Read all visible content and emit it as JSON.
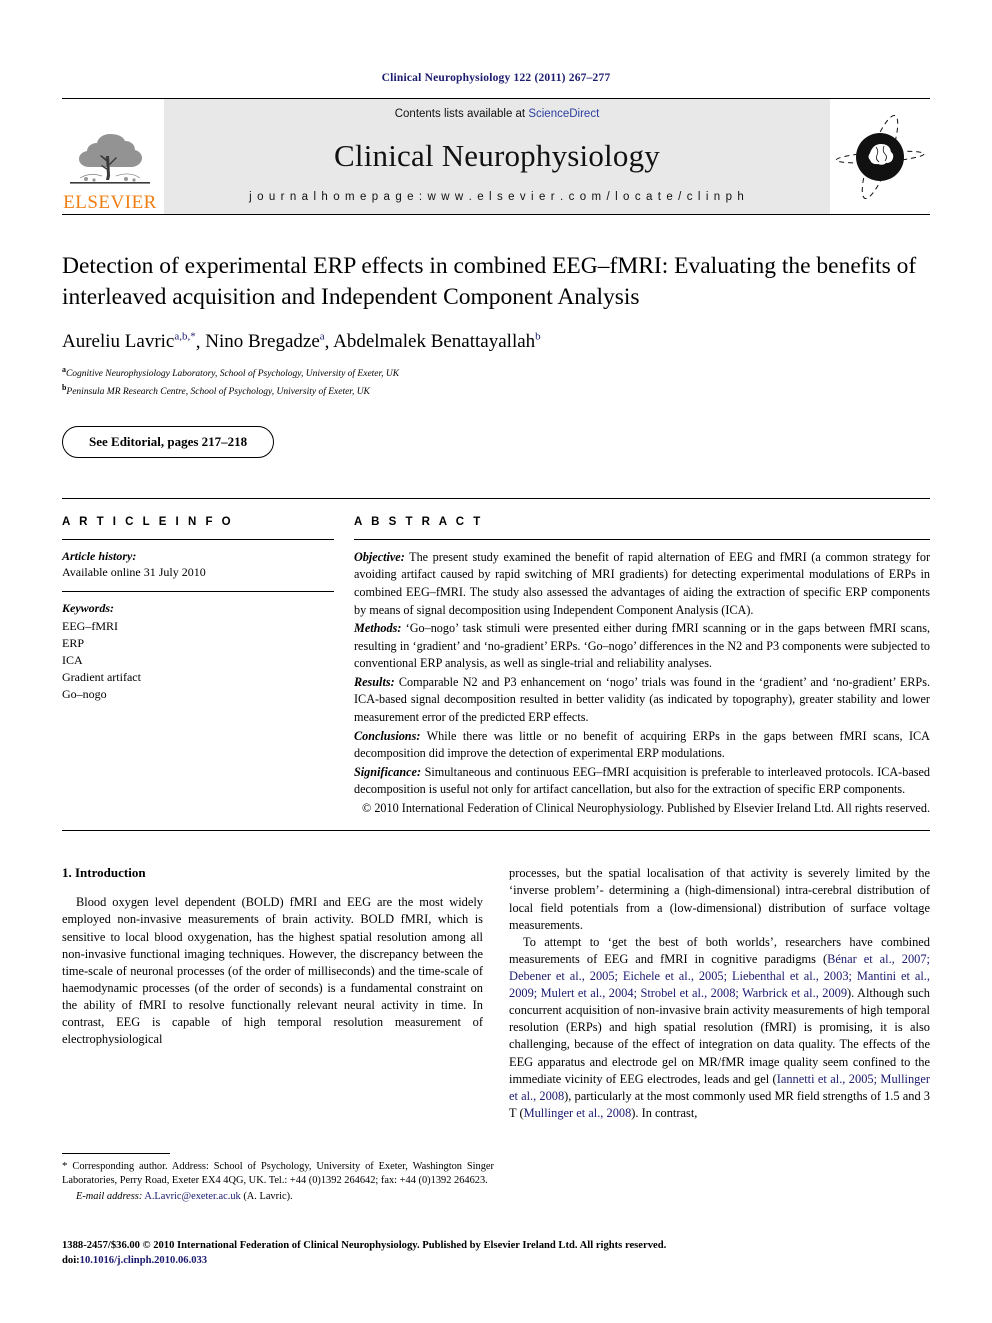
{
  "running_head": "Clinical Neurophysiology 122 (2011) 267–277",
  "masthead": {
    "contents_prefix": "Contents lists available at ",
    "sciencedirect": "ScienceDirect",
    "journal_name": "Clinical Neurophysiology",
    "homepage": "j o u r n a l   h o m e p a g e :   w w w . e l s e v i e r . c o m / l o c a t e / c l i n p h",
    "elsevier_wordmark": "ELSEVIER",
    "accent_orange": "#F07F13",
    "link_blue": "#2b3fa0",
    "banner_gray": "#e8e8e8"
  },
  "title": "Detection of experimental ERP effects in combined EEG–fMRI: Evaluating the benefits of interleaved acquisition and Independent Component Analysis",
  "authors": [
    {
      "name": "Aureliu Lavric",
      "sup": "a,b,*"
    },
    {
      "name": "Nino Bregadze",
      "sup": "a"
    },
    {
      "name": "Abdelmalek Benattayallah",
      "sup": "b"
    }
  ],
  "affiliations": [
    {
      "mark": "a",
      "text": "Cognitive Neurophysiology Laboratory, School of Psychology, University of Exeter, UK"
    },
    {
      "mark": "b",
      "text": "Peninsula MR Research Centre, School of Psychology, University of Exeter, UK"
    }
  ],
  "editorial_note": "See Editorial, pages 217–218",
  "article_info": {
    "heading": "A R T I C L E    I N F O",
    "history_label": "Article history:",
    "history_value": "Available online 31 July 2010",
    "keywords_label": "Keywords:",
    "keywords": [
      "EEG–fMRI",
      "ERP",
      "ICA",
      "Gradient artifact",
      "Go–nogo"
    ]
  },
  "abstract": {
    "heading": "A B S T R A C T",
    "sections": [
      {
        "label": "Objective:",
        "text": " The present study examined the benefit of rapid alternation of EEG and fMRI (a common strategy for avoiding artifact caused by rapid switching of MRI gradients) for detecting experimental modulations of ERPs in combined EEG–fMRI. The study also assessed the advantages of aiding the extraction of specific ERP components by means of signal decomposition using Independent Component Analysis (ICA)."
      },
      {
        "label": "Methods:",
        "text": " ‘Go–nogo’ task stimuli were presented either during fMRI scanning or in the gaps between fMRI scans, resulting in ‘gradient’ and ‘no-gradient’ ERPs. ‘Go–nogo’ differences in the N2 and P3 components were subjected to conventional ERP analysis, as well as single-trial and reliability analyses."
      },
      {
        "label": "Results:",
        "text": " Comparable N2 and P3 enhancement on ‘nogo’ trials was found in the ‘gradient’ and ‘no-gradient’ ERPs. ICA-based signal decomposition resulted in better validity (as indicated by topography), greater stability and lower measurement error of the predicted ERP effects."
      },
      {
        "label": "Conclusions:",
        "text": " While there was little or no benefit of acquiring ERPs in the gaps between fMRI scans, ICA decomposition did improve the detection of experimental ERP modulations."
      },
      {
        "label": "Significance:",
        "text": " Simultaneous and continuous EEG–fMRI acquisition is preferable to interleaved protocols. ICA-based decomposition is useful not only for artifact cancellation, but also for the extraction of specific ERP components."
      }
    ],
    "copyright": "© 2010 International Federation of Clinical Neurophysiology. Published by Elsevier Ireland Ltd. All rights reserved."
  },
  "body": {
    "section_title": "1. Introduction",
    "left_paragraph": "Blood oxygen level dependent (BOLD) fMRI and EEG are the most widely employed non-invasive measurements of brain activity. BOLD fMRI, which is sensitive to local blood oxygenation, has the highest spatial resolution among all non-invasive functional imaging techniques. However, the discrepancy between the time-scale of neuronal processes (of the order of milliseconds) and the time-scale of haemodynamic processes (of the order of seconds) is a fundamental constraint on the ability of fMRI to resolve functionally relevant neural activity in time. In contrast, EEG is capable of high temporal resolution measurement of electrophysiological",
    "right_paragraph_1": "processes, but the spatial localisation of that activity is severely limited by the ‘inverse problem’- determining a (high-dimensional) intra-cerebral distribution of local field potentials from a (low-dimensional) distribution of surface voltage measurements.",
    "right_paragraph_2_a": "To attempt to ‘get the best of both worlds’, researchers have combined measurements of EEG and fMRI in cognitive paradigms (",
    "right_citation_1": "Bénar et al., 2007; Debener et al., 2005; Eichele et al., 2005; Liebenthal et al., 2003; Mantini et al., 2009; Mulert et al., 2004; Strobel et al., 2008; Warbrick et al., 2009",
    "right_paragraph_2_b": "). Although such concurrent acquisition of non-invasive brain activity measurements of high temporal resolution (ERPs) and high spatial resolution (fMRI) is promising, it is also challenging, because of the effect of integration on data quality. The effects of the EEG apparatus and electrode gel on MR/fMR image quality seem confined to the immediate vicinity of EEG electrodes, leads and gel (",
    "right_citation_2": "Iannetti et al., 2005; Mullinger et al., 2008",
    "right_paragraph_2_c": "), particularly at the most commonly used MR field strengths of 1.5 and 3 T (",
    "right_citation_3": "Mullinger et al., 2008",
    "right_paragraph_2_d": "). In contrast,"
  },
  "footnote": {
    "star": "*",
    "text": " Corresponding author. Address: School of Psychology, University of Exeter, Washington Singer Laboratories, Perry Road, Exeter EX4 4QG, UK. Tel.: +44 (0)1392 264642; fax: +44 (0)1392 264623.",
    "email_label": "E-mail address:",
    "email": "A.Lavric@exeter.ac.uk",
    "email_suffix": " (A. Lavric)."
  },
  "imprint": {
    "line1": "1388-2457/$36.00 © 2010 International Federation of Clinical Neurophysiology. Published by Elsevier Ireland Ltd. All rights reserved.",
    "doi_label": "doi:",
    "doi_value": "10.1016/j.clinph.2010.06.033"
  }
}
